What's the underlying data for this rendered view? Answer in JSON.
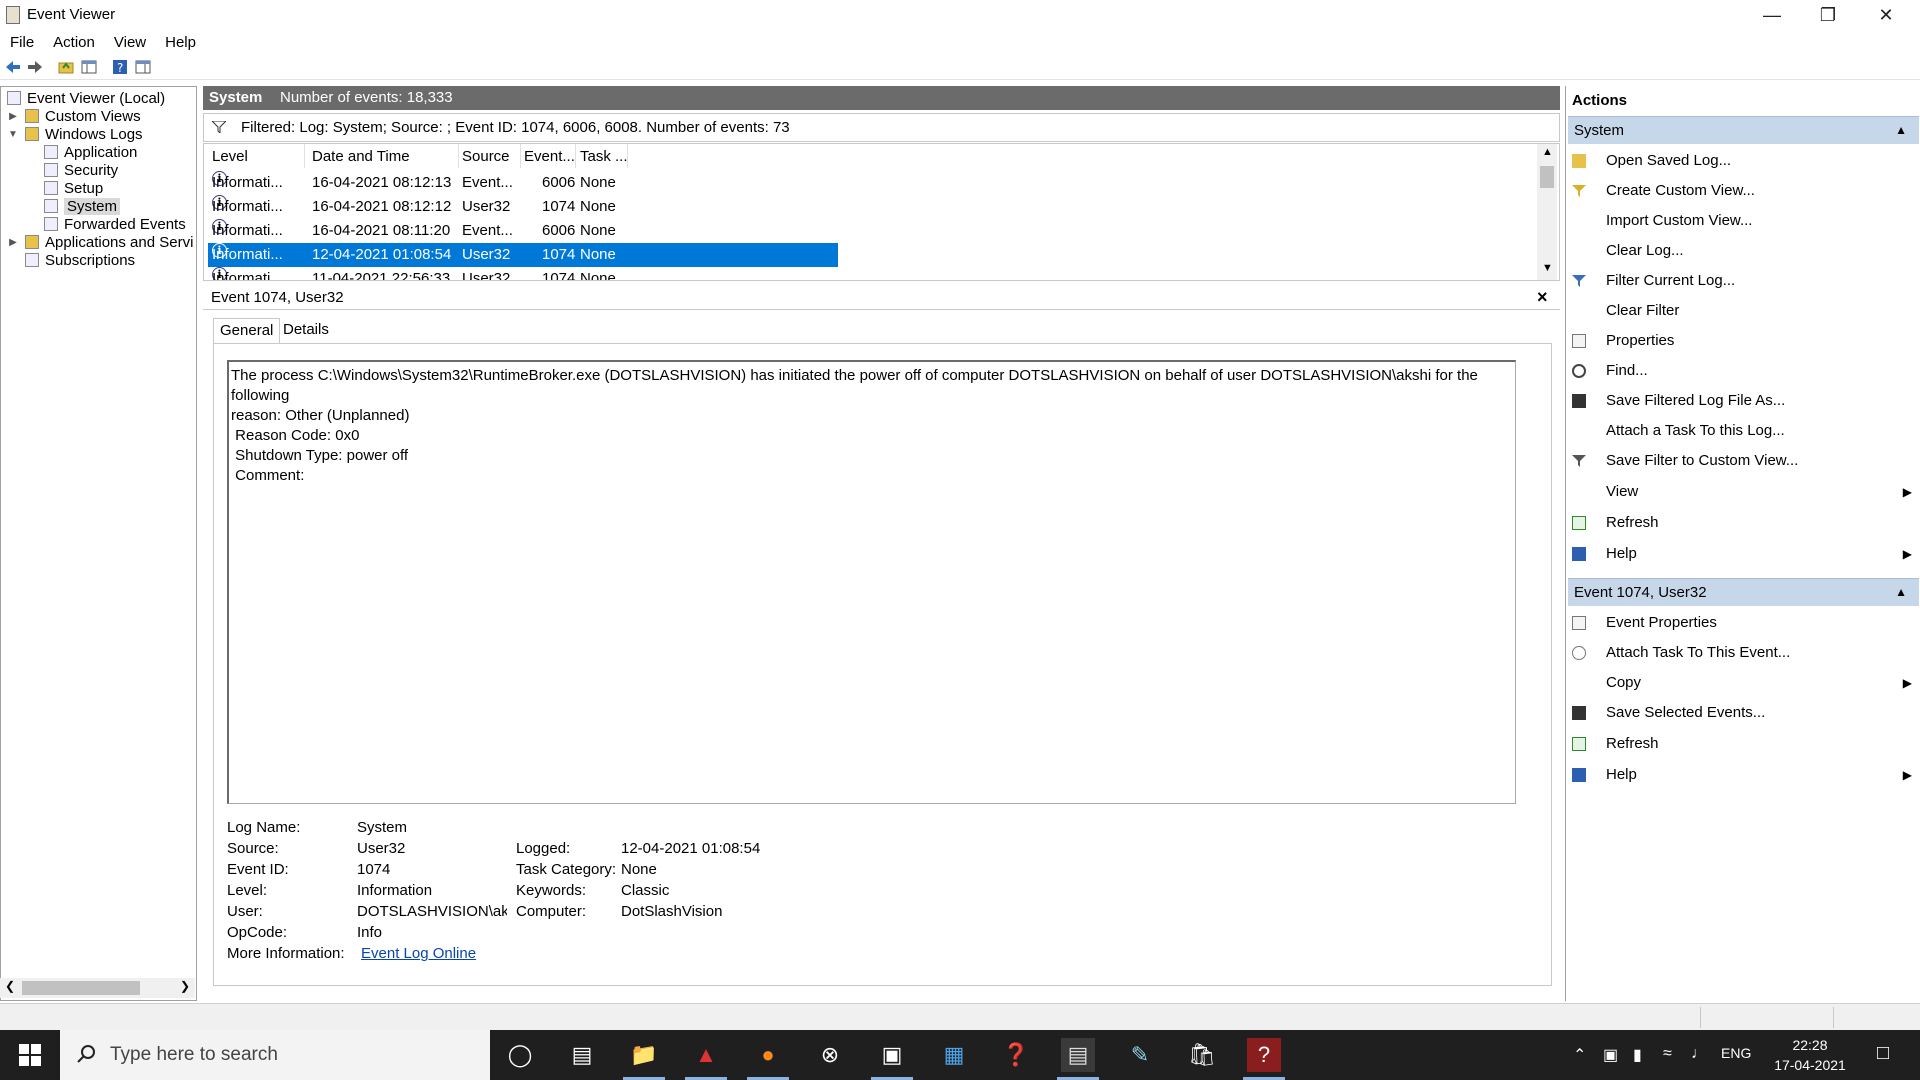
{
  "window": {
    "title": "Event Viewer"
  },
  "menu": [
    "File",
    "Action",
    "View",
    "Help"
  ],
  "toolbar_icons": [
    "back-arrow-icon",
    "forward-arrow-icon",
    "folder-up-icon",
    "console-tree-icon",
    "help-icon",
    "action-pane-icon"
  ],
  "tree": {
    "root": "Event Viewer (Local)",
    "custom_views": "Custom Views",
    "windows_logs": "Windows Logs",
    "logs": [
      "Application",
      "Security",
      "Setup",
      "System",
      "Forwarded Events"
    ],
    "apps_services": "Applications and Servi",
    "subscriptions": "Subscriptions"
  },
  "center": {
    "header_title": "System",
    "header_count": "Number of events: 18,333",
    "filter_text": "Filtered: Log: System; Source: ; Event ID: 1074, 6006, 6008. Number of events: 73",
    "columns": [
      "Level",
      "Date and Time",
      "Source",
      "Event...",
      "Task ..."
    ],
    "rows": [
      {
        "level": "Informati...",
        "date": "16-04-2021 08:12:13",
        "source": "Event...",
        "id": "6006",
        "task": "None"
      },
      {
        "level": "Informati...",
        "date": "16-04-2021 08:12:12",
        "source": "User32",
        "id": "1074",
        "task": "None"
      },
      {
        "level": "Informati...",
        "date": "16-04-2021 08:11:20",
        "source": "Event...",
        "id": "6006",
        "task": "None"
      },
      {
        "level": "Informati...",
        "date": "12-04-2021 01:08:54",
        "source": "User32",
        "id": "1074",
        "task": "None"
      },
      {
        "level": "Informati...",
        "date": "11-04-2021 22:56:33",
        "source": "User32",
        "id": "1074",
        "task": "None"
      }
    ]
  },
  "detail": {
    "title": "Event 1074, User32",
    "tabs": [
      "General",
      "Details"
    ],
    "message": [
      "The process C:\\Windows\\System32\\RuntimeBroker.exe (DOTSLASHVISION) has initiated the power off of computer DOTSLASHVISION on behalf of user DOTSLASHVISION\\akshi for the following",
      "reason: Other (Unplanned)",
      " Reason Code: 0x0",
      " Shutdown Type: power off",
      " Comment:"
    ],
    "labels": {
      "log_name": "Log Name:",
      "source": "Source:",
      "event_id": "Event ID:",
      "level": "Level:",
      "user": "User:",
      "opcode": "OpCode:",
      "more_info": "More Information:",
      "logged": "Logged:",
      "task_category": "Task Category:",
      "keywords": "Keywords:",
      "computer": "Computer:"
    },
    "values": {
      "log_name": "System",
      "source": "User32",
      "event_id": "1074",
      "level": "Information",
      "user": "DOTSLASHVISION\\aksl",
      "opcode": "Info",
      "more_info": "Event Log Online",
      "logged": "12-04-2021 01:08:54",
      "task_category": "None",
      "keywords": "Classic",
      "computer": "DotSlashVision"
    }
  },
  "actions": {
    "title": "Actions",
    "section1": "System",
    "items1": [
      "Open Saved Log...",
      "Create Custom View...",
      "Import Custom View...",
      "Clear Log...",
      "Filter Current Log...",
      "Clear Filter",
      "Properties",
      "Find...",
      "Save Filtered Log File As...",
      "Attach a Task To this Log...",
      "Save Filter to Custom View...",
      "View",
      "Refresh",
      "Help"
    ],
    "section2": "Event 1074, User32",
    "items2": [
      "Event Properties",
      "Attach Task To This Event...",
      "Copy",
      "Save Selected Events...",
      "Refresh",
      "Help"
    ]
  },
  "taskbar": {
    "search_placeholder": "Type here to search",
    "lang": "ENG",
    "time": "22:28",
    "date": "17-04-2021"
  },
  "colors": {
    "selection": "#0078d7",
    "header": "#6b6b6b",
    "actions_section": "#c7d7ea",
    "taskbar": "#1f1f1f",
    "link": "#0645ad"
  }
}
